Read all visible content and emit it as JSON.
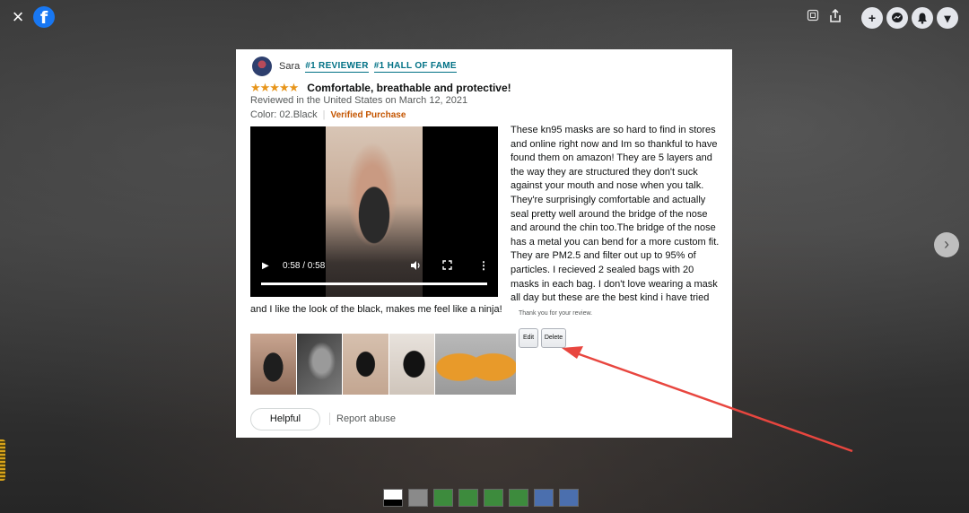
{
  "topbar": {
    "close_glyph": "×",
    "logo_glyph": "f",
    "icons": [
      "tag-icon",
      "share-icon"
    ],
    "actions": [
      {
        "name": "add-icon",
        "glyph": "+"
      },
      {
        "name": "messenger-icon",
        "glyph": "✉"
      },
      {
        "name": "notifications-icon",
        "glyph": "●"
      },
      {
        "name": "account-menu-icon",
        "glyph": "▾"
      }
    ]
  },
  "review": {
    "reviewer_name": "Sara",
    "badge_1": "#1 REVIEWER",
    "badge_2": "#1 HALL OF FAME",
    "stars_glyph": "★★★★★",
    "rating": 5,
    "title": "Comfortable, breathable and protective!",
    "reviewed_line": "Reviewed in the United States on March 12, 2021",
    "color_label": "Color: 02.Black",
    "verified": "Verified Purchase",
    "video_time": "0:58 / 0:58",
    "video_progress": 1.0,
    "body": "These kn95 masks are so hard to find in stores and online right now and Im so thankful to have found them on amazon! They are 5 layers and the way they are structured they don't suck against your mouth and nose when you talk. They're surprisingly comfortable and actually seal pretty well around the bridge of the nose and around the chin too.The bridge of the nose has a metal you can bend for a more custom fit. They are PM2.5 and filter out up to 95% of particles. I recieved 2 sealed bags with 20 masks in each bag. I don't love wearing a mask all day but these are the best kind i have tried",
    "body_tail": "and I like the look of the black, makes me feel like a ninja!",
    "thanks": "Thank you for your review.",
    "edit_label": "Edit",
    "delete_label": "Delete",
    "helpful_label": "Helpful",
    "report_label": "Report abuse"
  },
  "colors": {
    "accent_link": "#007185",
    "star": "#e7951b",
    "verified": "#c45500",
    "annotation_arrow": "#e8463f",
    "facebook": "#1877f2"
  }
}
